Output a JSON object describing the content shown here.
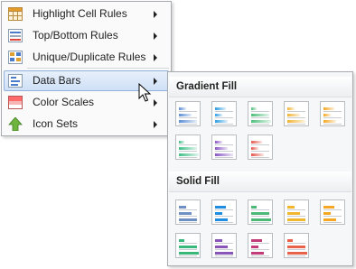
{
  "menu": {
    "items": [
      {
        "label": "Highlight Cell Rules",
        "icon": "highlight-cell-rules-icon",
        "has_submenu": true
      },
      {
        "label": "Top/Bottom Rules",
        "icon": "top-bottom-rules-icon",
        "has_submenu": true
      },
      {
        "label": "Unique/Duplicate Rules",
        "icon": "unique-duplicate-rules-icon",
        "has_submenu": true
      },
      {
        "label": "Data Bars",
        "icon": "data-bars-icon",
        "has_submenu": true,
        "selected": true
      },
      {
        "label": "Color Scales",
        "icon": "color-scales-icon",
        "has_submenu": true
      },
      {
        "label": "Icon Sets",
        "icon": "icon-sets-icon",
        "has_submenu": true
      }
    ]
  },
  "submenu": {
    "sections": [
      {
        "title": "Gradient Fill",
        "styles": [
          {
            "color": "#5b8dd6",
            "style": "gradient"
          },
          {
            "color": "#2f9de0",
            "style": "gradient"
          },
          {
            "color": "#4cbf7a",
            "style": "gradient"
          },
          {
            "color": "#f2b233",
            "style": "gradient"
          },
          {
            "color": "#f5a623",
            "style": "gradient"
          },
          {
            "color": "#3fbf86",
            "style": "gradient"
          },
          {
            "color": "#8a55c4",
            "style": "gradient"
          },
          {
            "color": "#e4574f",
            "style": "gradient"
          }
        ]
      },
      {
        "title": "Solid Fill",
        "styles": [
          {
            "color": "#6e8fc4",
            "style": "solid"
          },
          {
            "color": "#1f8de0",
            "style": "solid"
          },
          {
            "color": "#4cb878",
            "style": "solid"
          },
          {
            "color": "#f2b52e",
            "style": "solid"
          },
          {
            "color": "#f5a623",
            "style": "solid"
          },
          {
            "color": "#3ab87a",
            "style": "solid"
          },
          {
            "color": "#8a55b8",
            "style": "solid"
          },
          {
            "color": "#c23b7a",
            "style": "solid"
          },
          {
            "color": "#e8624a",
            "style": "solid"
          }
        ]
      }
    ]
  },
  "colors": {
    "accent": "#8fb1dc",
    "selected_bg": "#dce8f8"
  }
}
